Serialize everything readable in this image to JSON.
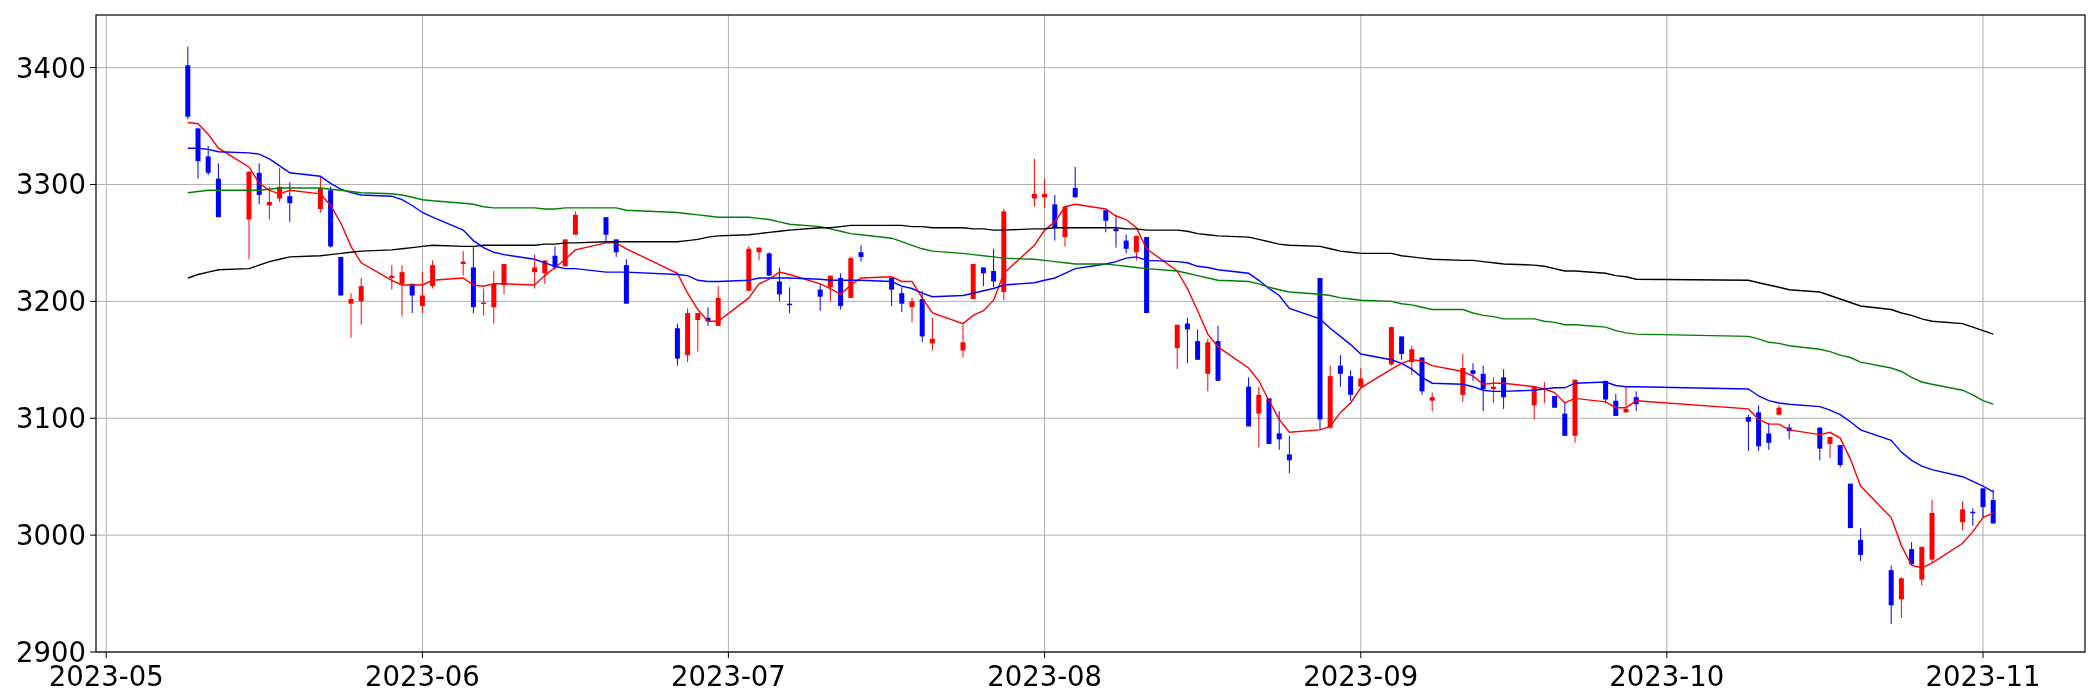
{
  "chart": {
    "chart_data": {
      "type": "candlestick",
      "grid": true,
      "xlim": [
        "2023-04-30",
        "2023-11-11"
      ],
      "ylim": [
        2900,
        3445
      ],
      "xticks": [
        {
          "value": "2023-05-01",
          "label": "2023-05"
        },
        {
          "value": "2023-06-01",
          "label": "2023-06"
        },
        {
          "value": "2023-07-01",
          "label": "2023-07"
        },
        {
          "value": "2023-08-01",
          "label": "2023-08"
        },
        {
          "value": "2023-09-01",
          "label": "2023-09"
        },
        {
          "value": "2023-10-01",
          "label": "2023-10"
        },
        {
          "value": "2023-11-01",
          "label": "2023-11"
        }
      ],
      "yticks": [
        {
          "value": 2900,
          "label": "2900"
        },
        {
          "value": 3000,
          "label": "3000"
        },
        {
          "value": 3100,
          "label": "3100"
        },
        {
          "value": 3200,
          "label": "3200"
        },
        {
          "value": 3300,
          "label": "3300"
        },
        {
          "value": 3400,
          "label": "3400"
        }
      ],
      "x": [
        "2023-05-09",
        "2023-05-10",
        "2023-05-11",
        "2023-05-12",
        "2023-05-15",
        "2023-05-16",
        "2023-05-17",
        "2023-05-18",
        "2023-05-19",
        "2023-05-22",
        "2023-05-23",
        "2023-05-24",
        "2023-05-25",
        "2023-05-26",
        "2023-05-29",
        "2023-05-30",
        "2023-05-31",
        "2023-06-01",
        "2023-06-02",
        "2023-06-05",
        "2023-06-06",
        "2023-06-07",
        "2023-06-08",
        "2023-06-09",
        "2023-06-12",
        "2023-06-13",
        "2023-06-14",
        "2023-06-15",
        "2023-06-16",
        "2023-06-19",
        "2023-06-20",
        "2023-06-21",
        "2023-06-26",
        "2023-06-27",
        "2023-06-28",
        "2023-06-29",
        "2023-06-30",
        "2023-07-03",
        "2023-07-04",
        "2023-07-05",
        "2023-07-06",
        "2023-07-07",
        "2023-07-10",
        "2023-07-11",
        "2023-07-12",
        "2023-07-13",
        "2023-07-14",
        "2023-07-17",
        "2023-07-18",
        "2023-07-19",
        "2023-07-20",
        "2023-07-21",
        "2023-07-24",
        "2023-07-25",
        "2023-07-26",
        "2023-07-27",
        "2023-07-28",
        "2023-07-31",
        "2023-08-01",
        "2023-08-02",
        "2023-08-03",
        "2023-08-04",
        "2023-08-07",
        "2023-08-08",
        "2023-08-09",
        "2023-08-10",
        "2023-08-11",
        "2023-08-14",
        "2023-08-15",
        "2023-08-16",
        "2023-08-17",
        "2023-08-18",
        "2023-08-21",
        "2023-08-22",
        "2023-08-23",
        "2023-08-24",
        "2023-08-25",
        "2023-08-28",
        "2023-08-29",
        "2023-08-30",
        "2023-08-31",
        "2023-09-01",
        "2023-09-04",
        "2023-09-05",
        "2023-09-06",
        "2023-09-07",
        "2023-09-08",
        "2023-09-11",
        "2023-09-12",
        "2023-09-13",
        "2023-09-14",
        "2023-09-15",
        "2023-09-18",
        "2023-09-19",
        "2023-09-20",
        "2023-09-21",
        "2023-09-22",
        "2023-09-25",
        "2023-09-26",
        "2023-09-27",
        "2023-09-28",
        "2023-10-09",
        "2023-10-10",
        "2023-10-11",
        "2023-10-12",
        "2023-10-13",
        "2023-10-16",
        "2023-10-17",
        "2023-10-18",
        "2023-10-19",
        "2023-10-20",
        "2023-10-23",
        "2023-10-24",
        "2023-10-25",
        "2023-10-26",
        "2023-10-27",
        "2023-10-30",
        "2023-10-31",
        "2023-11-01",
        "2023-11-02"
      ],
      "ohlc": [
        [
          3402,
          3418,
          3356,
          3358
        ],
        [
          3348,
          3348,
          3305,
          3320
        ],
        [
          3324,
          3333,
          3308,
          3310
        ],
        [
          3305,
          3318,
          3272,
          3272
        ],
        [
          3270,
          3311,
          3236,
          3311
        ],
        [
          3310,
          3318,
          3283,
          3291
        ],
        [
          3282,
          3298,
          3270,
          3285
        ],
        [
          3288,
          3314,
          3285,
          3298
        ],
        [
          3290,
          3302,
          3268,
          3284
        ],
        [
          3279,
          3307,
          3276,
          3297
        ],
        [
          3295,
          3298,
          3246,
          3247
        ],
        [
          3238,
          3238,
          3205,
          3205
        ],
        [
          3198,
          3207,
          3169,
          3202
        ],
        [
          3200,
          3220,
          3180,
          3213
        ],
        [
          3220,
          3231,
          3210,
          3222
        ],
        [
          3215,
          3231,
          3187,
          3225
        ],
        [
          3215,
          3215,
          3190,
          3205
        ],
        [
          3196,
          3225,
          3190,
          3205
        ],
        [
          3213,
          3235,
          3211,
          3231
        ],
        [
          3232,
          3243,
          3222,
          3234
        ],
        [
          3229,
          3247,
          3190,
          3195
        ],
        [
          3198,
          3211,
          3188,
          3199
        ],
        [
          3195,
          3226,
          3181,
          3215
        ],
        [
          3214,
          3232,
          3206,
          3232
        ],
        [
          3225,
          3240,
          3211,
          3229
        ],
        [
          3224,
          3235,
          3215,
          3235
        ],
        [
          3239,
          3247,
          3227,
          3229
        ],
        [
          3230,
          3253,
          3230,
          3253
        ],
        [
          3257,
          3277,
          3257,
          3274
        ],
        [
          3272,
          3272,
          3251,
          3257
        ],
        [
          3253,
          3253,
          3238,
          3242
        ],
        [
          3231,
          3236,
          3198,
          3198
        ],
        [
          3177,
          3181,
          3145,
          3151
        ],
        [
          3154,
          3194,
          3148,
          3190
        ],
        [
          3184,
          3190,
          3157,
          3190
        ],
        [
          3186,
          3195,
          3179,
          3183
        ],
        [
          3179,
          3213,
          3179,
          3203
        ],
        [
          3209,
          3247,
          3209,
          3245
        ],
        [
          3242,
          3246,
          3235,
          3246
        ],
        [
          3241,
          3242,
          3222,
          3222
        ],
        [
          3217,
          3229,
          3200,
          3206
        ],
        [
          3198,
          3212,
          3190,
          3197
        ],
        [
          3210,
          3215,
          3192,
          3204
        ],
        [
          3212,
          3222,
          3200,
          3222
        ],
        [
          3220,
          3224,
          3193,
          3196
        ],
        [
          3203,
          3238,
          3203,
          3237
        ],
        [
          3242,
          3248,
          3234,
          3238
        ],
        [
          3220,
          3220,
          3196,
          3210
        ],
        [
          3207,
          3212,
          3191,
          3198
        ],
        [
          3195,
          3203,
          3182,
          3200
        ],
        [
          3202,
          3209,
          3165,
          3170
        ],
        [
          3164,
          3186,
          3158,
          3168
        ],
        [
          3158,
          3180,
          3152,
          3165
        ],
        [
          3202,
          3232,
          3202,
          3232
        ],
        [
          3229,
          3229,
          3213,
          3224
        ],
        [
          3226,
          3245,
          3212,
          3217
        ],
        [
          3208,
          3279,
          3201,
          3277
        ],
        [
          3288,
          3322,
          3281,
          3292
        ],
        [
          3289,
          3305,
          3280,
          3292
        ],
        [
          3283,
          3291,
          3252,
          3263
        ],
        [
          3255,
          3281,
          3247,
          3281
        ],
        [
          3297,
          3315,
          3289,
          3289
        ],
        [
          3278,
          3278,
          3259,
          3269
        ],
        [
          3262,
          3274,
          3246,
          3260
        ],
        [
          3252,
          3257,
          3241,
          3245
        ],
        [
          3242,
          3256,
          3235,
          3256
        ],
        [
          3255,
          3255,
          3190,
          3190
        ],
        [
          3160,
          3180,
          3142,
          3180
        ],
        [
          3181,
          3186,
          3147,
          3176
        ],
        [
          3166,
          3176,
          3150,
          3150
        ],
        [
          3138,
          3168,
          3123,
          3165
        ],
        [
          3166,
          3179,
          3132,
          3132
        ],
        [
          3127,
          3135,
          3093,
          3093
        ],
        [
          3104,
          3127,
          3075,
          3120
        ],
        [
          3117,
          3117,
          3078,
          3078
        ],
        [
          3087,
          3106,
          3073,
          3082
        ],
        [
          3069,
          3085,
          3053,
          3064
        ],
        [
          3220,
          3220,
          3090,
          3099
        ],
        [
          3092,
          3145,
          3091,
          3136
        ],
        [
          3145,
          3154,
          3127,
          3138
        ],
        [
          3136,
          3141,
          3115,
          3120
        ],
        [
          3127,
          3143,
          3127,
          3134
        ],
        [
          3146,
          3178,
          3145,
          3178
        ],
        [
          3170,
          3170,
          3150,
          3155
        ],
        [
          3148,
          3162,
          3137,
          3159
        ],
        [
          3152,
          3152,
          3120,
          3123
        ],
        [
          3115,
          3122,
          3106,
          3118
        ],
        [
          3120,
          3155,
          3114,
          3143
        ],
        [
          3141,
          3147,
          3132,
          3138
        ],
        [
          3138,
          3145,
          3106,
          3125
        ],
        [
          3125,
          3135,
          3113,
          3127
        ],
        [
          3135,
          3142,
          3108,
          3118
        ],
        [
          3111,
          3127,
          3099,
          3127
        ],
        [
          3125,
          3131,
          3113,
          3126
        ],
        [
          3119,
          3119,
          3109,
          3109
        ],
        [
          3104,
          3113,
          3085,
          3085
        ],
        [
          3085,
          3133,
          3079,
          3133
        ],
        [
          3132,
          3132,
          3113,
          3116
        ],
        [
          3115,
          3121,
          3102,
          3102
        ],
        [
          3105,
          3127,
          3105,
          3108
        ],
        [
          3118,
          3123,
          3106,
          3112
        ],
        [
          3101,
          3103,
          3072,
          3097
        ],
        [
          3105,
          3111,
          3072,
          3076
        ],
        [
          3087,
          3096,
          3073,
          3079
        ],
        [
          3103,
          3111,
          3103,
          3109
        ],
        [
          3092,
          3095,
          3082,
          3089
        ],
        [
          3092,
          3092,
          3064,
          3074
        ],
        [
          3078,
          3084,
          3066,
          3084
        ],
        [
          3077,
          3077,
          3058,
          3060
        ],
        [
          3044,
          3044,
          3006,
          3006
        ],
        [
          2996,
          3006,
          2978,
          2983
        ],
        [
          2970,
          2974,
          2924,
          2940
        ],
        [
          2945,
          2964,
          2929,
          2963
        ],
        [
          2988,
          2994,
          2974,
          2975
        ],
        [
          2962,
          2990,
          2957,
          2990
        ],
        [
          2979,
          3030,
          2976,
          3019
        ],
        [
          3011,
          3029,
          3004,
          3022
        ],
        [
          3020,
          3023,
          3008,
          3019
        ],
        [
          3040,
          3040,
          3015,
          3024
        ],
        [
          3030,
          3039,
          3010,
          3010
        ]
      ],
      "series": [
        {
          "type": "line",
          "color": "#ff0000",
          "values": [
            3353,
            3352,
            3343,
            3331,
            3315,
            3301,
            3295,
            3292,
            3295,
            3292,
            3282,
            3267,
            3247,
            3233,
            3218,
            3214,
            3214,
            3214,
            3218,
            3220,
            3214,
            3213,
            3215,
            3215,
            3214,
            3222,
            3229,
            3236,
            3244,
            3250,
            3250,
            3245,
            3224,
            3207,
            3193,
            3183,
            3183,
            3203,
            3215,
            3219,
            3225,
            3223,
            3215,
            3211,
            3206,
            3214,
            3220,
            3221,
            3217,
            3217,
            3203,
            3190,
            3181,
            3188,
            3192,
            3201,
            3224,
            3248,
            3261,
            3268,
            3281,
            3283,
            3279,
            3273,
            3270,
            3263,
            3245,
            3226,
            3211,
            3192,
            3172,
            3161,
            3143,
            3132,
            3115,
            3099,
            3088,
            3090,
            3093,
            3105,
            3113,
            3126,
            3142,
            3147,
            3150,
            3149,
            3145,
            3140,
            3136,
            3129,
            3130,
            3130,
            3127,
            3125,
            3122,
            3113,
            3117,
            3114,
            3109,
            3109,
            3115,
            3108,
            3099,
            3095,
            3095,
            3090,
            3086,
            3088,
            3083,
            3065,
            3042,
            3015,
            2991,
            2974,
            2972,
            2976,
            2993,
            3003,
            3015,
            3019
          ]
        },
        {
          "type": "line",
          "color": "#0000ff",
          "values": [
            3331,
            3331,
            3330,
            3328,
            3327,
            3326,
            3322,
            3316,
            3310,
            3307,
            3301,
            3296,
            3293,
            3291,
            3290,
            3287,
            3282,
            3276,
            3272,
            3261,
            3252,
            3246,
            3242,
            3240,
            3236,
            3233,
            3230,
            3228,
            3228,
            3225,
            3225,
            3225,
            3223,
            3222,
            3218,
            3217,
            3217,
            3218,
            3220,
            3220,
            3220,
            3220,
            3219,
            3218,
            3218,
            3218,
            3218,
            3217,
            3213,
            3211,
            3207,
            3204,
            3205,
            3207,
            3209,
            3211,
            3214,
            3216,
            3218,
            3220,
            3224,
            3228,
            3232,
            3234,
            3237,
            3238,
            3235,
            3234,
            3233,
            3230,
            3229,
            3227,
            3224,
            3218,
            3211,
            3205,
            3194,
            3185,
            3177,
            3170,
            3163,
            3155,
            3150,
            3147,
            3142,
            3135,
            3130,
            3129,
            3127,
            3124,
            3123,
            3123,
            3124,
            3125,
            3126,
            3126,
            3130,
            3131,
            3128,
            3127,
            3127,
            3125,
            3119,
            3115,
            3113,
            3112,
            3110,
            3107,
            3103,
            3097,
            3090,
            3081,
            3071,
            3064,
            3059,
            3056,
            3050,
            3046,
            3042,
            3037
          ]
        },
        {
          "type": "line",
          "color": "#008000",
          "values": [
            3293,
            3294,
            3295,
            3295,
            3295,
            3295,
            3296,
            3297,
            3297,
            3297,
            3296,
            3295,
            3294,
            3293,
            3292,
            3291,
            3289,
            3287,
            3286,
            3284,
            3283,
            3281,
            3280,
            3280,
            3280,
            3279,
            3279,
            3280,
            3280,
            3280,
            3280,
            3278,
            3276,
            3275,
            3274,
            3273,
            3272,
            3272,
            3271,
            3270,
            3268,
            3266,
            3264,
            3262,
            3260,
            3258,
            3257,
            3254,
            3251,
            3248,
            3245,
            3243,
            3241,
            3240,
            3239,
            3238,
            3237,
            3236,
            3235,
            3234,
            3233,
            3232,
            3232,
            3231,
            3230,
            3229,
            3228,
            3226,
            3224,
            3222,
            3220,
            3218,
            3217,
            3215,
            3212,
            3210,
            3208,
            3206,
            3205,
            3203,
            3202,
            3201,
            3200,
            3198,
            3197,
            3195,
            3193,
            3193,
            3190,
            3188,
            3187,
            3185,
            3185,
            3183,
            3182,
            3180,
            3180,
            3178,
            3175,
            3173,
            3172,
            3170,
            3168,
            3165,
            3164,
            3162,
            3159,
            3157,
            3154,
            3152,
            3148,
            3143,
            3140,
            3135,
            3131,
            3129,
            3124,
            3120,
            3115,
            3112
          ]
        },
        {
          "type": "line",
          "color": "#000000",
          "values": [
            3220,
            3223,
            3225,
            3227,
            3228,
            3231,
            3234,
            3236,
            3238,
            3239,
            3240,
            3241,
            3242,
            3243,
            3244,
            3245,
            3246,
            3247,
            3248,
            3247,
            3247,
            3248,
            3248,
            3248,
            3248,
            3249,
            3249,
            3250,
            3250,
            3251,
            3251,
            3251,
            3251,
            3252,
            3253,
            3255,
            3256,
            3257,
            3258,
            3259,
            3260,
            3261,
            3263,
            3263,
            3264,
            3265,
            3265,
            3265,
            3265,
            3264,
            3264,
            3263,
            3263,
            3262,
            3262,
            3261,
            3261,
            3262,
            3262,
            3263,
            3263,
            3263,
            3263,
            3263,
            3262,
            3262,
            3261,
            3261,
            3260,
            3258,
            3257,
            3256,
            3255,
            3253,
            3251,
            3249,
            3248,
            3247,
            3245,
            3243,
            3242,
            3241,
            3241,
            3239,
            3238,
            3237,
            3236,
            3235,
            3235,
            3234,
            3233,
            3232,
            3231,
            3230,
            3228,
            3226,
            3226,
            3224,
            3222,
            3221,
            3219,
            3218,
            3216,
            3214,
            3212,
            3210,
            3208,
            3205,
            3202,
            3199,
            3196,
            3193,
            3190,
            3188,
            3185,
            3183,
            3181,
            3178,
            3175,
            3172
          ]
        }
      ]
    }
  }
}
